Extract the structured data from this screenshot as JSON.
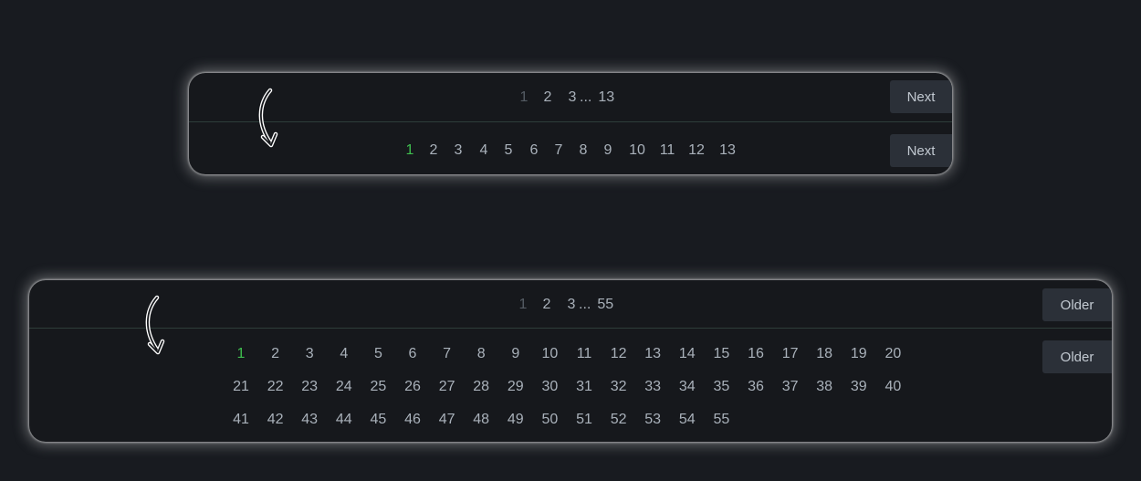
{
  "colors": {
    "background": "#181b20",
    "card": "#16181c",
    "button": "#2b3038",
    "page_text": "#a9b1ba",
    "disabled_page": "#555c64",
    "active_page": "#3fbf4f"
  },
  "example1": {
    "compact": {
      "pages": [
        "1",
        "2",
        "3"
      ],
      "ellipsis": "...",
      "last": "13",
      "next_label": "Next"
    },
    "expanded": {
      "pages": [
        "1",
        "2",
        "3",
        "4",
        "5",
        "6",
        "7",
        "8",
        "9",
        "10",
        "11",
        "12",
        "13"
      ],
      "active": "1",
      "next_label": "Next"
    }
  },
  "example2": {
    "compact": {
      "pages": [
        "1",
        "2",
        "3"
      ],
      "ellipsis": "...",
      "last": "55",
      "older_label": "Older"
    },
    "expanded": {
      "rows": [
        [
          "1",
          "2",
          "3",
          "4",
          "5",
          "6",
          "7",
          "8",
          "9",
          "10",
          "11",
          "12",
          "13",
          "14",
          "15",
          "16",
          "17",
          "18",
          "19",
          "20"
        ],
        [
          "21",
          "22",
          "23",
          "24",
          "25",
          "26",
          "27",
          "28",
          "29",
          "30",
          "31",
          "32",
          "33",
          "34",
          "35",
          "36",
          "37",
          "38",
          "39",
          "40"
        ],
        [
          "41",
          "42",
          "43",
          "44",
          "45",
          "46",
          "47",
          "48",
          "49",
          "50",
          "51",
          "52",
          "53",
          "54",
          "55"
        ]
      ],
      "active": "1",
      "older_label": "Older"
    }
  }
}
